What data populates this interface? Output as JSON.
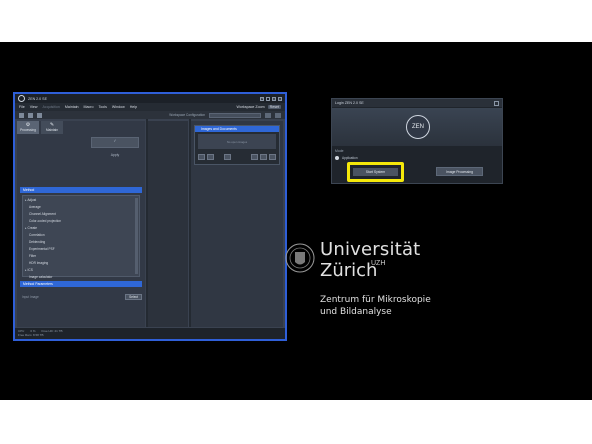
{
  "zen_window": {
    "title": "ZEN 2.0 SE",
    "menu": [
      "File",
      "View",
      "Acquisition",
      "Maintain",
      "Macro",
      "Tools",
      "Window",
      "Help"
    ],
    "mode_label": "Workspace Zoom",
    "reset_label": "Reset",
    "workspace_config_label": "Workspace Configuration",
    "tabs": [
      {
        "label": "Processing",
        "icon": "gear-icon"
      },
      {
        "label": "Maintain",
        "icon": "wrench-icon"
      }
    ],
    "apply_label": "Apply",
    "method_section": "Method",
    "methods": [
      {
        "label": "Adjust",
        "kind": "grp"
      },
      {
        "label": "Average",
        "kind": "sub"
      },
      {
        "label": "Channel Alignment",
        "kind": "sub"
      },
      {
        "label": "Color-coded projection",
        "kind": "sub"
      },
      {
        "label": "Create",
        "kind": "grp"
      },
      {
        "label": "Correlation",
        "kind": "sub"
      },
      {
        "label": "Deblending",
        "kind": "sub"
      },
      {
        "label": "Experimental PSF",
        "kind": "sub"
      },
      {
        "label": "Filter",
        "kind": "sub"
      },
      {
        "label": "HDR Imaging",
        "kind": "sub"
      },
      {
        "label": "ICS",
        "kind": "grp"
      },
      {
        "label": "Image calculator",
        "kind": "sub"
      }
    ],
    "method_params_section": "Method Parameters",
    "input_image_label": "Input Image",
    "select_label": "Select",
    "images_docs_title": "Images and Documents",
    "images_docs_empty": "No open images",
    "status_row1": [
      "CPU",
      "0 %",
      "Free HD: 21 TB"
    ],
    "status_row2": [
      "Free Ram: 8.58 TB"
    ]
  },
  "login_dialog": {
    "title": "Login ZEN 2.0 SE",
    "logo_text": "ZEN",
    "mode_label": "Mode",
    "radio_label": "Application",
    "start_button": "Start System",
    "image_processing_button": "Image Processing"
  },
  "branding": {
    "line1": "Universität",
    "line2": "Zürich",
    "superscript": "UZH",
    "subtitle1": "Zentrum für Mikroskopie",
    "subtitle2": "und Bildanalyse"
  },
  "colors": {
    "accent": "#2f67d6",
    "highlight": "#f5e80a",
    "background": "#000000"
  }
}
